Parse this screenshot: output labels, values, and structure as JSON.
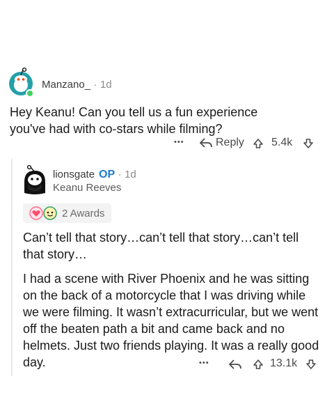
{
  "comment": {
    "username": "Manzano_",
    "separator": "·",
    "time": "1d",
    "text": "Hey Keanu! Can you tell us a fun experience you've had with co-stars while filming?",
    "more": "•••",
    "reply_label": "Reply",
    "score": "5.4k",
    "avatar_icon": "reddit-snoo-icon"
  },
  "reply": {
    "username": "lionsgate",
    "op_badge": "OP",
    "separator": "·",
    "time": "1d",
    "flair": "Keanu Reeves",
    "awards_label": "2 Awards",
    "paragraph1": "Can’t tell that story…can’t tell that story…can’t tell that story…",
    "paragraph2": "I had a scene with River Phoenix and he was sitting on the back of a motorcycle that I was driving while we were filming. It wasn’t extracurricular, but we went off the beaten path a bit and came back and no helmets. Just two friends playing. It was a really good day.",
    "more": "•••",
    "score": "13.1k",
    "avatar_icon": "keanu-snoo-avatar-icon"
  },
  "colors": {
    "op_blue": "#1a7bd0",
    "online_green": "#46d160",
    "avatar_teal": "#24a0a8"
  }
}
